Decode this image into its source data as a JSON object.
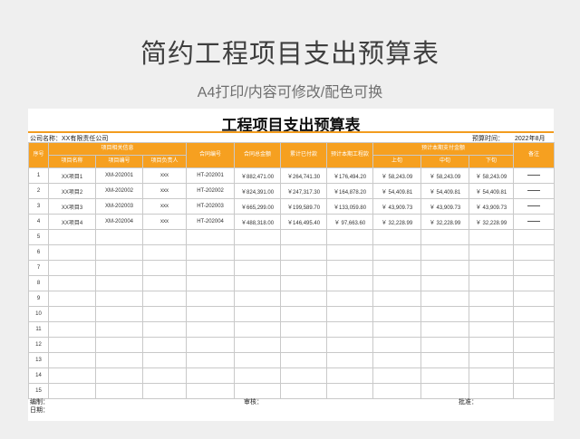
{
  "header": {
    "title": "简约工程项目支出预算表",
    "subtitle": "A4打印/内容可修改/配色可换"
  },
  "sheet": {
    "title": "工程项目支出预算表",
    "company": "公司名称：XX有限责任公司",
    "budget_time_label": "预算时间：",
    "budget_time": "2022年8月"
  },
  "table": {
    "h_index": "序号",
    "h_project_group": "项目相关信息",
    "h_name": "项目名称",
    "h_code": "项目编号",
    "h_manager": "项目负责人",
    "h_contract_no": "合同编号",
    "h_contract_total": "合同总金额",
    "h_paid": "累计已付款",
    "h_expected": "预计本期工程款",
    "h_plan_group": "预计本期支付金额",
    "h_upper": "上旬",
    "h_middle": "中旬",
    "h_lower": "下旬",
    "h_remark": "备注",
    "rows": [
      {
        "idx": "1",
        "name": "XX项目1",
        "code": "XM-202001",
        "manager": "xxx",
        "contract": "HT-202001",
        "total": "￥882,471.00",
        "paid": "￥264,741.30",
        "expected": "￥176,494.20",
        "upper": "￥ 58,243.09",
        "middle": "￥ 58,243.09",
        "lower": "￥ 58,243.09"
      },
      {
        "idx": "2",
        "name": "XX项目2",
        "code": "XM-202002",
        "manager": "xxx",
        "contract": "HT-202002",
        "total": "￥824,391.00",
        "paid": "￥247,317.30",
        "expected": "￥164,878.20",
        "upper": "￥ 54,409.81",
        "middle": "￥ 54,409.81",
        "lower": "￥ 54,409.81"
      },
      {
        "idx": "3",
        "name": "XX项目3",
        "code": "XM-202003",
        "manager": "xxx",
        "contract": "HT-202003",
        "total": "￥665,299.00",
        "paid": "￥199,589.70",
        "expected": "￥133,059.80",
        "upper": "￥ 43,909.73",
        "middle": "￥ 43,909.73",
        "lower": "￥ 43,909.73"
      },
      {
        "idx": "4",
        "name": "XX项目4",
        "code": "XM-202004",
        "manager": "xxx",
        "contract": "HT-202004",
        "total": "￥488,318.00",
        "paid": "￥146,495.40",
        "expected": "￥ 97,663.60",
        "upper": "￥ 32,228.99",
        "middle": "￥ 32,228.99",
        "lower": "￥ 32,228.99"
      }
    ],
    "empty_indices": [
      "5",
      "6",
      "7",
      "8",
      "9",
      "10",
      "11",
      "12",
      "13",
      "14",
      "15"
    ]
  },
  "footer": {
    "editor": "编制：",
    "date": "日期：",
    "reviewer": "审核：",
    "approver": "批准："
  },
  "colors": {
    "accent": "#f6a020",
    "page_bg": "#efefef"
  }
}
